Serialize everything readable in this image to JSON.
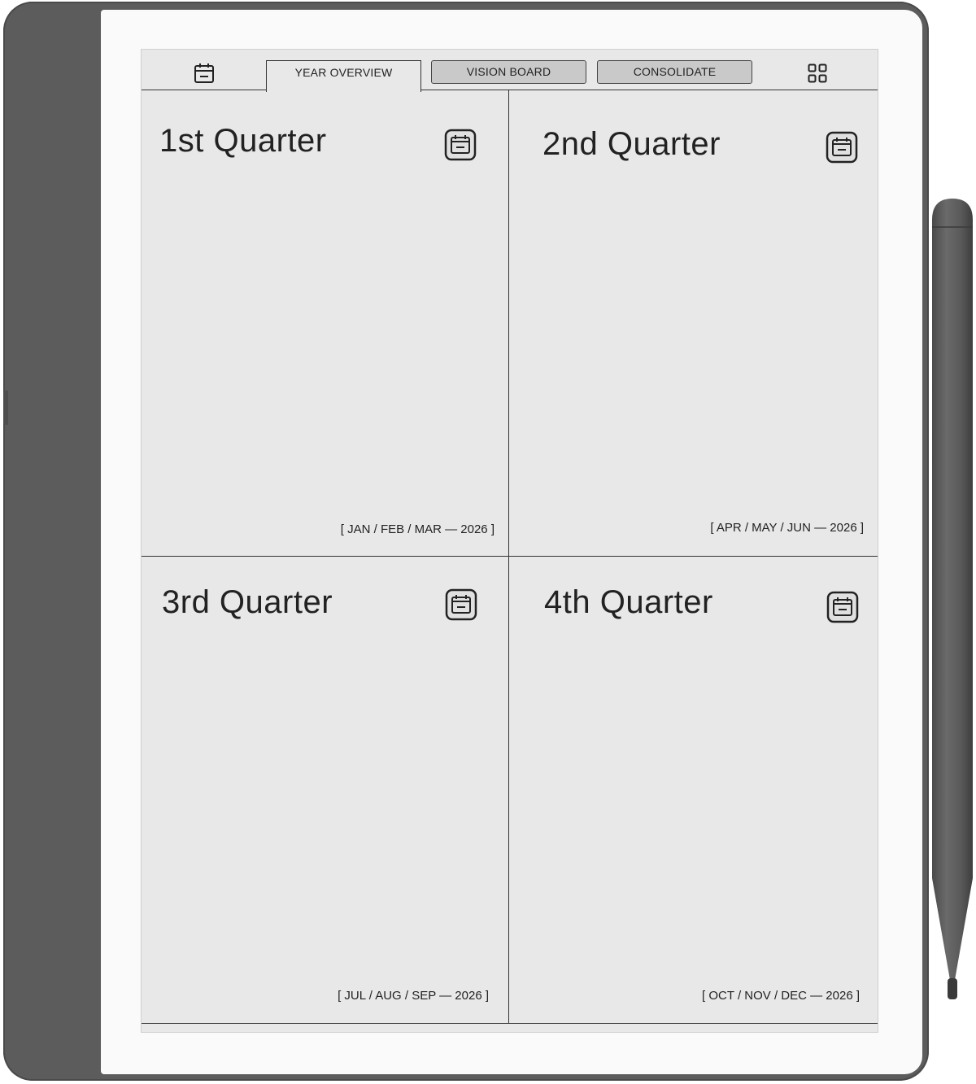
{
  "tabs": {
    "home_icon": "calendar-icon",
    "year_overview": "YEAR OVERVIEW",
    "vision_board": "VISION BOARD",
    "consolidate": "CONSOLIDATE",
    "grid_icon": "grid-icon"
  },
  "quarters": [
    {
      "title": "1st Quarter",
      "range": "[ JAN / FEB / MAR — 2026 ]",
      "icon": "calendar-icon"
    },
    {
      "title": "2nd Quarter",
      "range": "[ APR / MAY / JUN — 2026 ]",
      "icon": "calendar-icon"
    },
    {
      "title": "3rd Quarter",
      "range": "[ JUL / AUG / SEP — 2026 ]",
      "icon": "calendar-icon"
    },
    {
      "title": "4th Quarter",
      "range": "[ OCT / NOV / DEC — 2026 ]",
      "icon": "calendar-icon"
    }
  ],
  "colors": {
    "device_body": "#5c5c5c",
    "screen": "#e8e8e8",
    "inactive_tab": "#c9c9c9",
    "ink": "#222222"
  }
}
